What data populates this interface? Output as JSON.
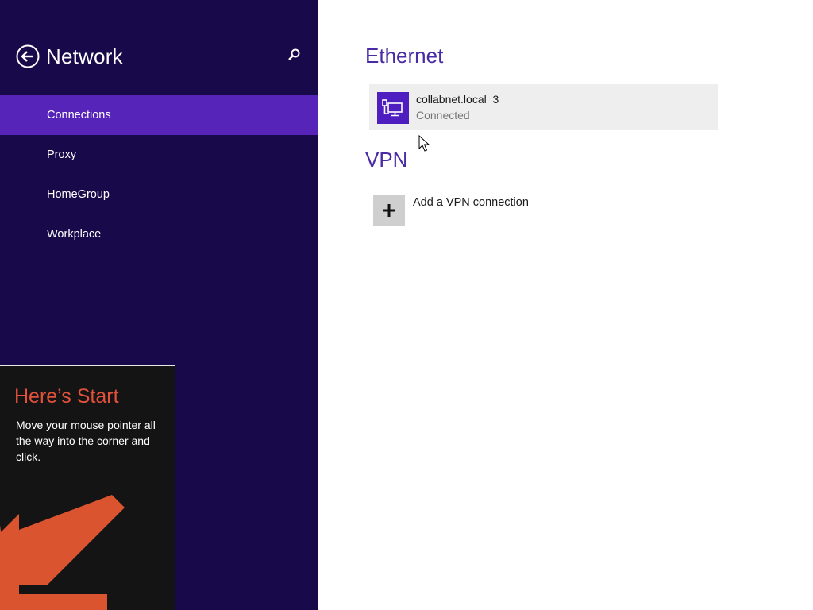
{
  "sidebar": {
    "title": "Network",
    "back_icon": "back-arrow-circle-icon",
    "search_icon": "search-icon",
    "items": [
      {
        "label": "Connections",
        "selected": true
      },
      {
        "label": "Proxy",
        "selected": false
      },
      {
        "label": "HomeGroup",
        "selected": false
      },
      {
        "label": "Workplace",
        "selected": false
      }
    ]
  },
  "ethernet": {
    "heading": "Ethernet",
    "connection": {
      "name": "collabnet.local  3",
      "status": "Connected",
      "icon": "wired-network-icon"
    }
  },
  "vpn": {
    "heading": "VPN",
    "add_label": "Add a VPN connection",
    "add_icon": "plus-icon"
  },
  "start_tip": {
    "title": "Here’s Start",
    "body": "Move your mouse pointer all the way into the corner and click.",
    "arrow_icon": "arrow-down-left-icon"
  },
  "colors": {
    "sidebar_bg": "#180a4a",
    "selected_bg": "#5624b8",
    "accent": "#4a2ba6",
    "tip_title": "#e2513a",
    "tip_arrow": "#d9542f"
  }
}
